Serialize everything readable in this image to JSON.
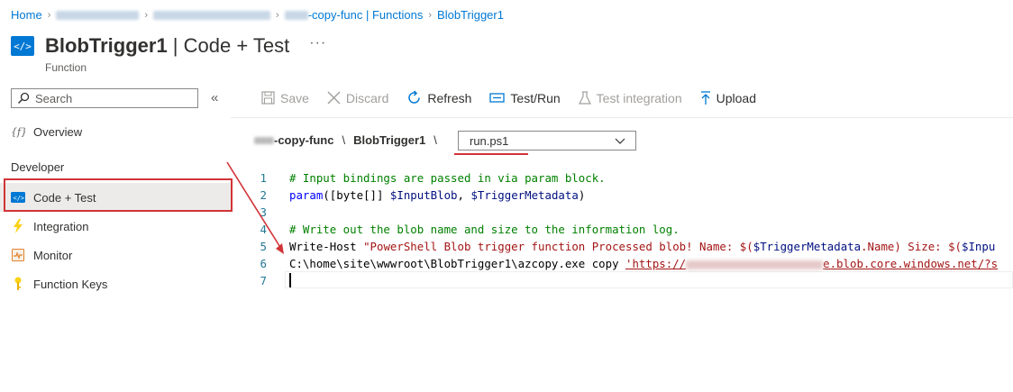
{
  "breadcrumb": {
    "home": "Home",
    "app": "-copy-func | Functions",
    "current": "BlobTrigger1"
  },
  "header": {
    "title_bold": "BlobTrigger1",
    "title_rest": " | Code + Test",
    "more": "···",
    "subtitle": "Function",
    "icon": "function-code-icon"
  },
  "sidebar": {
    "search_placeholder": "Search",
    "collapse": "«",
    "overview": "Overview",
    "section": "Developer",
    "items": [
      {
        "label": "Code + Test",
        "icon": "code-icon"
      },
      {
        "label": "Integration",
        "icon": "lightning-icon"
      },
      {
        "label": "Monitor",
        "icon": "monitor-icon"
      },
      {
        "label": "Function Keys",
        "icon": "key-icon"
      }
    ]
  },
  "toolbar": {
    "save": "Save",
    "discard": "Discard",
    "refresh": "Refresh",
    "test_run": "Test/Run",
    "test_integration": "Test integration",
    "upload": "Upload"
  },
  "path": {
    "app": "-copy-func",
    "sep": "\\",
    "function": "BlobTrigger1"
  },
  "file_select": {
    "value": "run.ps1"
  },
  "editor": {
    "lines": [
      {
        "num": "1",
        "text": "# Input bindings are passed in via param block."
      },
      {
        "num": "2",
        "p1": "param",
        "p2": "([byte[]] ",
        "p3": "$InputBlob",
        "p4": ", ",
        "p5": "$TriggerMetadata",
        "p6": ")"
      },
      {
        "num": "3"
      },
      {
        "num": "4",
        "text": "# Write out the blob name and size to the information log."
      },
      {
        "num": "5",
        "p1": "Write-Host ",
        "p2": "\"PowerShell Blob trigger function Processed blob! Name: $(",
        "p3": "$TriggerMetadata",
        "p4": ".Name) Size: $(",
        "p5": "$Inpu"
      },
      {
        "num": "6",
        "p1": "C:\\home\\site\\wwwroot\\BlobTrigger1\\azcopy.exe copy ",
        "p2": "'https://",
        "p3": "e.blob.core.windows.net/?s"
      },
      {
        "num": "7"
      }
    ]
  },
  "colors": {
    "accent": "#0078d4",
    "highlight": "#d13438"
  }
}
